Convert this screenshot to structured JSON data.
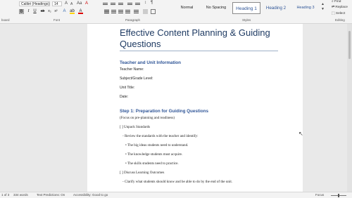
{
  "ribbon": {
    "font_name": "Calibri (Headings)",
    "font_size": "14",
    "group_labels": {
      "clipboard": "board",
      "font": "Font",
      "paragraph": "Paragraph",
      "styles": "Styles",
      "editing": "Editing"
    },
    "styles": [
      "Normal",
      "No Spacing",
      "Heading 1",
      "Heading 2",
      "Heading 3"
    ],
    "selected_style": "Heading 1",
    "editing": {
      "find": "Find",
      "replace": "Replace",
      "select": "Select"
    }
  },
  "document": {
    "title": "Effective Content Planning & Guiding Questions",
    "section1_heading": "Teacher and Unit Information",
    "teacher_name": "Teacher Name:",
    "subject": "Subject/Grade Level:",
    "unit_title": "Unit Title:",
    "date": "Date:",
    "step1_heading": "Step 1: Preparation for Guiding Questions",
    "step1_focus": "(Focus on pre-planning and readiness)",
    "unpack": "[ ] Unpack Standards",
    "review": "- Review the standards with the teacher and identify:",
    "bullet1": "• The big ideas students need to understand.",
    "bullet2": "• The knowledge students must acquire.",
    "bullet3": "• The skills students need to practice.",
    "discuss": "[ ] Discuss Learning Outcomes",
    "clarify": "- Clarify what students should know and be able to do by the end of the unit."
  },
  "status": {
    "page": "1 of 3",
    "words": "334 words",
    "text_predictions": "Text Predictions: On",
    "accessibility": "Accessibility: Good to go",
    "focus": "Focus"
  },
  "colors": {
    "heading_blue": "#2f5597",
    "title_navy": "#1f3b63"
  }
}
